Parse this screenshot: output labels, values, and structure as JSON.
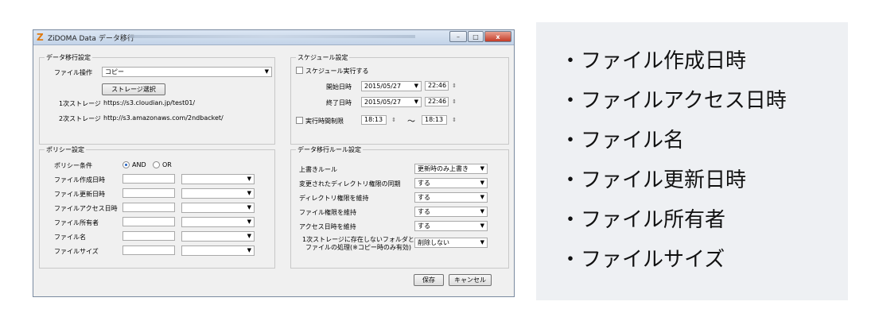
{
  "window": {
    "logo": "Z",
    "title": "ZiDOMA Data データ移行",
    "buttons": [
      "–",
      "□",
      "x"
    ]
  },
  "migration": {
    "group_title": "データ移行設定",
    "op_label": "ファイル操作",
    "op_value": "コピー",
    "storage_button": "ストレージ選択",
    "primary_label": "1次ストレージ",
    "primary_value": "https://s3.cloudian.jp/test01/",
    "secondary_label": "2次ストレージ",
    "secondary_value": "http://s3.amazonaws.com/2ndbacket/"
  },
  "schedule": {
    "group_title": "スケジュール設定",
    "exec_check": "スケジュール実行する",
    "start_label": "開始日時",
    "start_date": "2015/05/27",
    "start_time": "22:46",
    "end_label": "終了日時",
    "end_date": "2015/05/27",
    "end_time": "22:46",
    "limit_check": "実行時間制限",
    "limit_from": "18:13",
    "tilde": "～",
    "limit_to": "18:13"
  },
  "policy": {
    "group_title": "ポリシー設定",
    "cond_label": "ポリシー条件",
    "and_label": "AND",
    "or_label": "OR",
    "rows": [
      "ファイル作成日時",
      "ファイル更新日時",
      "ファイルアクセス日時",
      "ファイル所有者",
      "ファイル名",
      "ファイルサイズ"
    ]
  },
  "rules": {
    "group_title": "データ移行ルール設定",
    "rows": [
      {
        "label": "上書きルール",
        "value": "更新時のみ上書き"
      },
      {
        "label": "変更されたディレクトリ権限の同期",
        "value": "する"
      },
      {
        "label": "ディレクトリ権限を維持",
        "value": "する"
      },
      {
        "label": "ファイル権限を維持",
        "value": "する"
      },
      {
        "label": "アクセス日時を維持",
        "value": "する"
      }
    ],
    "last_label_1": "1次ストレージに存在しないフォルダと",
    "last_label_2": "ファイルの処理(※コピー時のみ有効)",
    "last_value": "削除しない"
  },
  "footer": {
    "save": "保存",
    "cancel": "キャンセル"
  },
  "bullets": [
    "・ファイル作成日時",
    "・ファイルアクセス日時",
    "・ファイル名",
    "・ファイル更新日時",
    "・ファイル所有者",
    "・ファイルサイズ"
  ]
}
